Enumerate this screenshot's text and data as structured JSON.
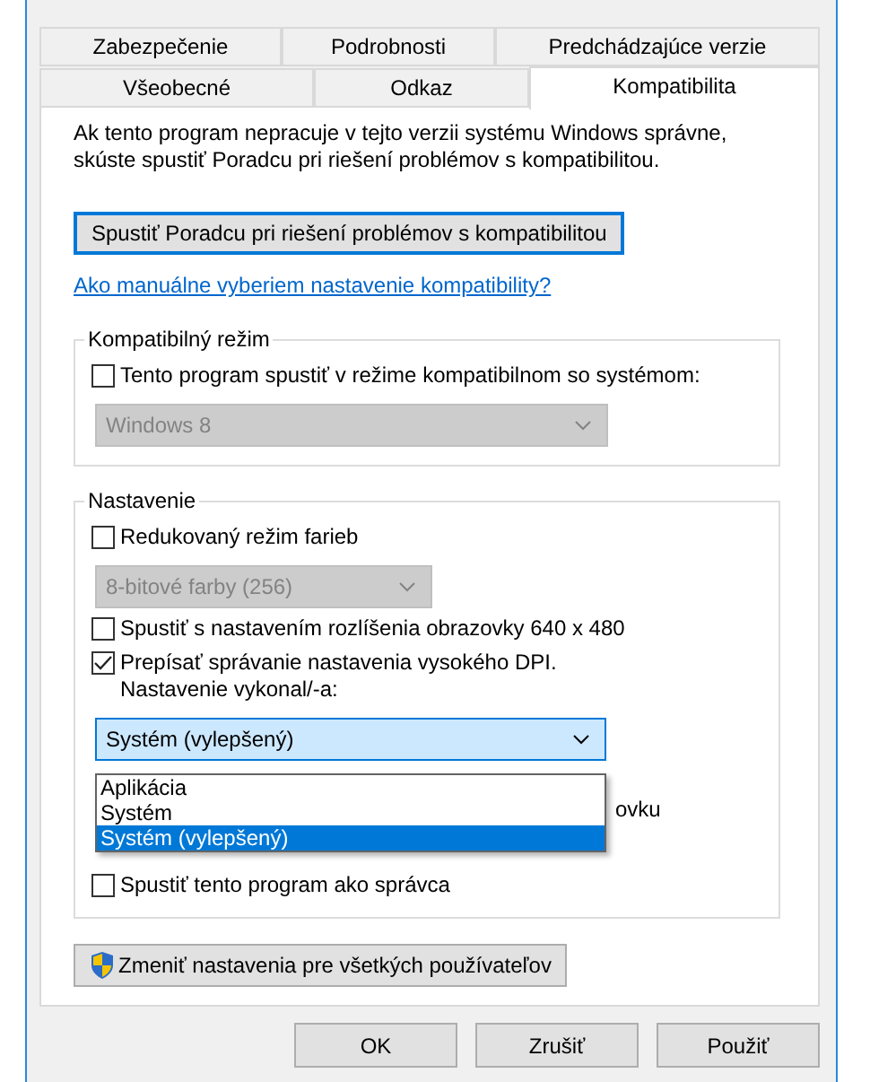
{
  "tabs": [
    [
      {
        "label": "Zabezpečenie",
        "selected": false
      },
      {
        "label": "Podrobnosti",
        "selected": false
      },
      {
        "label": "Predchádzajúce verzie",
        "selected": false
      }
    ],
    [
      {
        "label": "Všeobecné",
        "selected": false
      },
      {
        "label": "Odkaz",
        "selected": false
      },
      {
        "label": "Kompatibilita",
        "selected": true
      }
    ]
  ],
  "intro": "Ak tento program nepracuje v tejto verzii systému Windows správne, skúste spustiť Poradcu pri riešení problémov s kompatibilitou.",
  "troubleshoot_button": "Spustiť Poradcu pri riešení problémov s kompatibilitou",
  "help_link": "Ako manuálne vyberiem nastavenie kompatibility?",
  "compat_group": {
    "title": "Kompatibilný režim",
    "items": [
      {
        "kind": "checkbox",
        "label": "Tento program spustiť v režime kompatibilnom so systémom:",
        "checked": false
      },
      {
        "kind": "select",
        "value": "Windows 8",
        "disabled": true
      }
    ]
  },
  "settings_group": {
    "title": "Nastavenie",
    "items": [
      {
        "kind": "checkbox",
        "label": "Redukovaný režim farieb",
        "checked": false
      },
      {
        "kind": "select",
        "value": "8-bitové farby (256)",
        "disabled": true
      },
      {
        "kind": "checkbox",
        "label": "Spustiť s nastavením rozlíšenia obrazovky 640 x 480",
        "checked": false
      },
      {
        "kind": "checkbox",
        "label": "Prepísať správanie nastavenia vysokého DPI.\nNastavenie vykonal/-a:",
        "checked": true
      },
      {
        "kind": "open_select",
        "value": "Systém (vylepšený)",
        "covered_text": "ovku",
        "options": [
          {
            "label": "Aplikácia",
            "selected": false
          },
          {
            "label": "Systém",
            "selected": false
          },
          {
            "label": "Systém (vylepšený)",
            "selected": true
          }
        ]
      },
      {
        "kind": "checkbox",
        "label": "Spustiť tento program ako správca",
        "checked": false
      }
    ]
  },
  "all_users_button": "Zmeniť nastavenia pre všetkých používateľov",
  "buttons": [
    "OK",
    "Zrušiť",
    "Použiť"
  ]
}
